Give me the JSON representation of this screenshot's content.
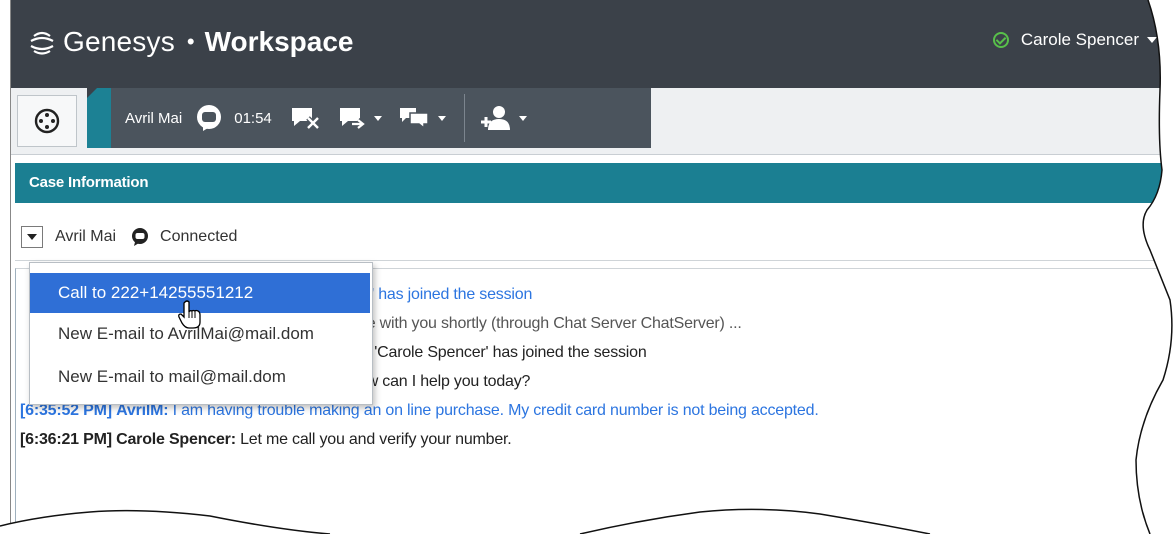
{
  "app": {
    "brand_name": "Genesys",
    "separator": "•",
    "product_name": "Workspace",
    "brand_icon": "genesys-logo-icon"
  },
  "user": {
    "name": "Carole Spencer",
    "status_icon": "status-ready-icon",
    "status_color": "#58c04a"
  },
  "toolbar": {
    "interaction": {
      "contact_name": "Avril Mai",
      "media_icon": "chat-bubble-icon",
      "timer": "01:54"
    },
    "buttons": [
      {
        "icon": "end-chat-icon",
        "has_menu": false
      },
      {
        "icon": "transfer-chat-icon",
        "has_menu": true
      },
      {
        "icon": "conference-chat-icon",
        "has_menu": true
      },
      {
        "icon": "party-actions-icon",
        "has_menu": true
      }
    ],
    "accent_color": "#1c8194"
  },
  "case": {
    "header": "Case Information",
    "party": {
      "name": "Avril Mai",
      "status_icon": "chat-bubble-icon",
      "status": "Connected"
    }
  },
  "menu": {
    "items": [
      {
        "label": "Call to 222+14255551212",
        "active": true
      },
      {
        "label": "New E-mail to AvrilMai@mail.dom",
        "active": false
      },
      {
        "label": "New E-mail to mail@mail.dom",
        "active": false
      }
    ],
    "highlight_color": "#2f6fd6"
  },
  "transcript": {
    "lines": [
      {
        "time": "",
        "sender": "",
        "text": "M' has joined the session",
        "color": "blue"
      },
      {
        "time": "",
        "sender": "",
        "text": "be with you shortly (through Chat Server ChatServer) ...",
        "color": "gray"
      },
      {
        "time": "",
        "sender": "",
        "text": "ty 'Carole Spencer' has joined the session",
        "color": "dark"
      },
      {
        "time": "",
        "sender": "",
        "text": "ow can I help you today?",
        "color": "dark"
      },
      {
        "time": "[6:35:52 PM]",
        "sender": "AvrilM:",
        "text": "I am having trouble making an on line purchase. My credit card number is not being accepted.",
        "color": "blue"
      },
      {
        "time": "[6:36:21 PM]",
        "sender": "Carole Spencer:",
        "text": "Let me call you and verify your number.",
        "color": "dark"
      }
    ]
  }
}
